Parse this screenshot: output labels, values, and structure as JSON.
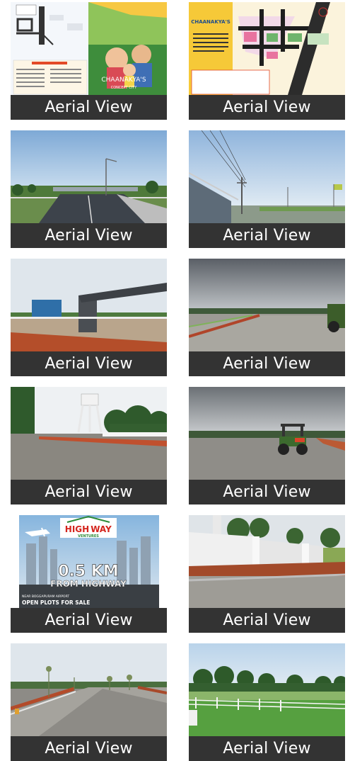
{
  "gallery": {
    "items": [
      {
        "caption": "Aerial View",
        "scene": "brochure-front",
        "brand": "CHAANAKYA'S",
        "brand_sub": "CONCEPT CITY"
      },
      {
        "caption": "Aerial View",
        "scene": "brochure-map",
        "brand": "CHAANAKYA'S"
      },
      {
        "caption": "Aerial View",
        "scene": "highway"
      },
      {
        "caption": "Aerial View",
        "scene": "power-lines"
      },
      {
        "caption": "Aerial View",
        "scene": "entrance-arch"
      },
      {
        "caption": "Aerial View",
        "scene": "cloudy-road"
      },
      {
        "caption": "Aerial View",
        "scene": "water-tower"
      },
      {
        "caption": "Aerial View",
        "scene": "tractor"
      },
      {
        "caption": "Aerial View",
        "scene": "ad-banner",
        "ad": {
          "logo_top": "HIGH",
          "logo_mid": "WAY",
          "logo_sub": "VENTURES",
          "headline": "0.5 KM",
          "subline": "FROM HIGHWAY",
          "footer_small": "NEAR BOGGAPURAM AIRPORT",
          "footer": "OPEN PLOTS FOR SALE"
        }
      },
      {
        "caption": "Aerial View",
        "scene": "compound-wall"
      },
      {
        "caption": "Aerial View",
        "scene": "road-saplings"
      },
      {
        "caption": "Aerial View",
        "scene": "lawn-fence"
      }
    ]
  },
  "colors": {
    "caption_bg": "#333333",
    "caption_text": "#ffffff",
    "ad_red": "#d4241c",
    "ad_green": "#2e8b3a"
  }
}
